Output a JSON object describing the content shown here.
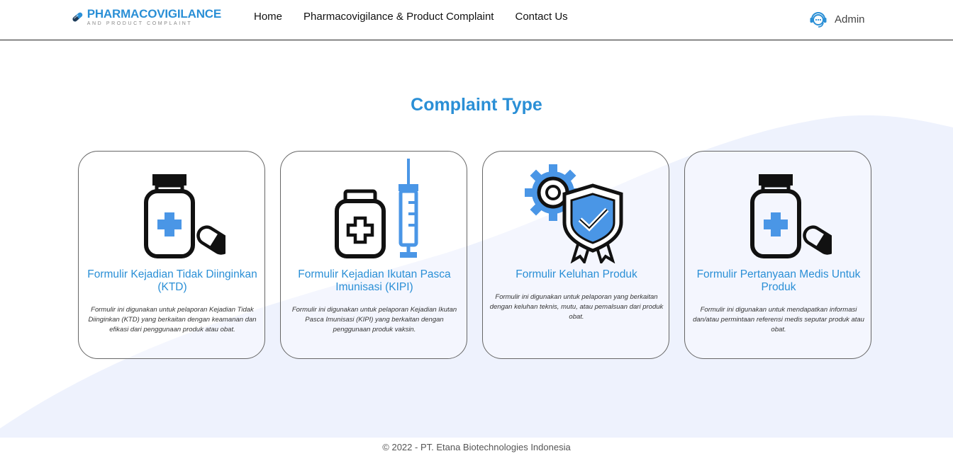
{
  "header": {
    "logo": {
      "main": "PHARMACOVIGILANCE",
      "sub": "AND PRODUCT COMPLAINT"
    },
    "nav": [
      {
        "label": "Home"
      },
      {
        "label": "Pharmacovigilance & Product Complaint"
      },
      {
        "label": "Contact Us"
      }
    ],
    "user": {
      "name": "Admin",
      "icon": "support-agent-icon"
    }
  },
  "section": {
    "title": "Complaint Type"
  },
  "cards": [
    {
      "icon": "medicine-bottle-pill-icon",
      "title": "Formulir Kejadian Tidak Diinginkan (KTD)",
      "description": "Formulir ini digunakan untuk pelaporan Kejadian Tidak Diinginkan (KTD) yang berkaitan dengan keamanan dan efikasi dari penggunaan produk atau obat."
    },
    {
      "icon": "vaccine-bottle-syringe-icon",
      "title": "Formulir Kejadian Ikutan Pasca Imunisasi (KIPI)",
      "description": "Formulir ini digunakan untuk pelaporan Kejadian Ikutan Pasca Imunisasi (KIPI) yang berkaitan dengan penggunaan produk vaksin."
    },
    {
      "icon": "quality-shield-gear-icon",
      "title": "Formulir Keluhan Produk",
      "description": "Formulir ini digunakan untuk pelaporan yang berkaitan dengan keluhan teknis, mutu, atau pemalsuan dari produk obat."
    },
    {
      "icon": "medicine-bottle-pill-icon",
      "title": "Formulir Pertanyaan Medis Untuk Produk",
      "description": "Formulir ini digunakan untuk mendapatkan informasi dan/atau permintaan referensi medis seputar produk atau obat."
    }
  ],
  "footer": {
    "text": "© 2022 - PT. Etana Biotechnologies Indonesia"
  },
  "colors": {
    "accent": "#2a8fd6",
    "icon_blue": "#4a96e6",
    "wave": "#eef2fd"
  }
}
